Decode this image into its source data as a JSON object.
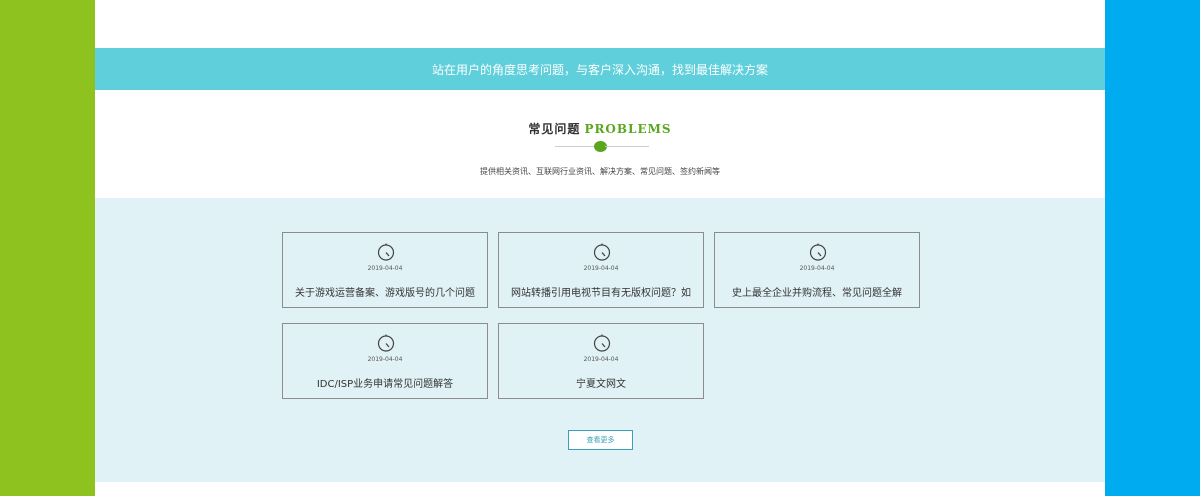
{
  "banner": {
    "text": "站在用户的角度思考问题，与客户深入沟通，找到最佳解决方案"
  },
  "section": {
    "title_cn": "常见问题",
    "title_en": "PROBLEMS",
    "subtitle": "提供相关资讯、互联网行业资讯、解决方案、常见问题、签约新闻等"
  },
  "articles": [
    {
      "date": "2019-04-04",
      "title": "关于游戏运营备案、游戏版号的几个问题",
      "icon": "clock-icon"
    },
    {
      "date": "2019-04-04",
      "title": "网站转播引用电视节目有无版权问题？如",
      "icon": "clock-icon"
    },
    {
      "date": "2019-04-04",
      "title": "史上最全企业并购流程、常见问题全解",
      "icon": "clock-icon"
    },
    {
      "date": "2019-04-04",
      "title": "IDC/ISP业务申请常见问题解答",
      "icon": "clock-icon"
    },
    {
      "date": "2019-04-04",
      "title": "宁夏文网文",
      "icon": "clock-icon"
    }
  ],
  "more_button": {
    "label": "查看更多"
  },
  "colors": {
    "left_side": "#8dc21f",
    "right_side": "#00acef",
    "banner": "#5ecfdb",
    "accent_green": "#5aa71f",
    "panel": "#e1f2f7"
  }
}
